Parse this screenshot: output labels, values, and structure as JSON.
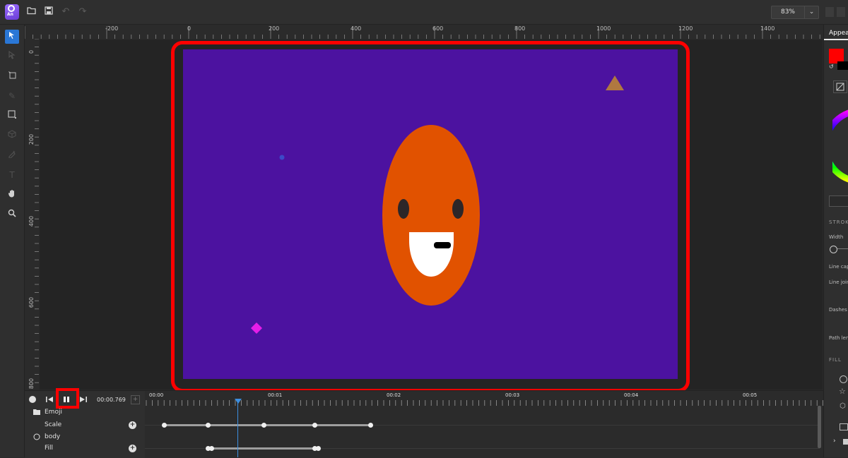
{
  "app": {
    "logo_text": "An",
    "toolbar_icons": [
      "folder-open-icon",
      "save-icon",
      "undo-icon",
      "redo-icon"
    ],
    "zoom_value": "83%",
    "zoom_dropdown_glyph": "⌄"
  },
  "tools": [
    {
      "name": "select-tool",
      "glyph": "➤",
      "active": true
    },
    {
      "name": "node-select-tool",
      "glyph": "▷",
      "active": false,
      "dim": true
    },
    {
      "name": "transform-tool",
      "glyph": "⤡",
      "active": false
    },
    {
      "name": "pen-tool",
      "glyph": "✎",
      "active": false,
      "dim": true
    },
    {
      "name": "shape-tool",
      "glyph": "□",
      "active": false
    },
    {
      "name": "3d-box-tool",
      "glyph": "▣",
      "active": false,
      "dim": true
    },
    {
      "name": "eyedropper-tool",
      "glyph": "✒",
      "active": false,
      "dim": true
    },
    {
      "name": "text-tool",
      "glyph": "T",
      "active": false,
      "dim": true
    },
    {
      "name": "hand-tool",
      "glyph": "✋",
      "active": false
    },
    {
      "name": "zoom-tool",
      "glyph": "⌕",
      "active": false
    }
  ],
  "rulers": {
    "unit": "px",
    "top_labels": [
      "-200",
      "0",
      "200",
      "400",
      "600",
      "800",
      "1000",
      "1200",
      "1400"
    ],
    "left_labels": [
      "0",
      "200",
      "400",
      "600",
      "800"
    ]
  },
  "canvas": {
    "stage_color": "#4c12a0",
    "body_color": "#e15200",
    "triangle_color": "#b07840",
    "diamond_color": "#e51ee8",
    "dot_color": "#3c49c8",
    "highlight_color": "#ff0000"
  },
  "right_panel": {
    "tab_label": "Appearance",
    "fill_swatch_color": "#ff0000",
    "stroke_section": "STROKE",
    "width_label": "Width",
    "line_cap_label": "Line cap",
    "line_join_label": "Line join",
    "dashes_label": "Dashes",
    "path_length_label": "Path length",
    "fill_section": "FILL"
  },
  "timeline": {
    "current_time": "00:00.769",
    "time_labels": [
      "00:00",
      "00:01",
      "00:02",
      "00:03",
      "00:04",
      "00:05"
    ],
    "layers": [
      {
        "name": "Emoji",
        "type": "group",
        "icon": "folder-icon"
      },
      {
        "name": "Scale",
        "type": "property"
      },
      {
        "name": "body",
        "type": "shape",
        "icon": "ellipse-icon"
      },
      {
        "name": "Fill",
        "type": "property"
      }
    ],
    "scale_keyframe_times": [
      0.15,
      0.52,
      0.99,
      1.42,
      1.89
    ],
    "fill_keyframe_times": [
      0.52,
      0.55,
      1.42,
      1.45
    ]
  }
}
